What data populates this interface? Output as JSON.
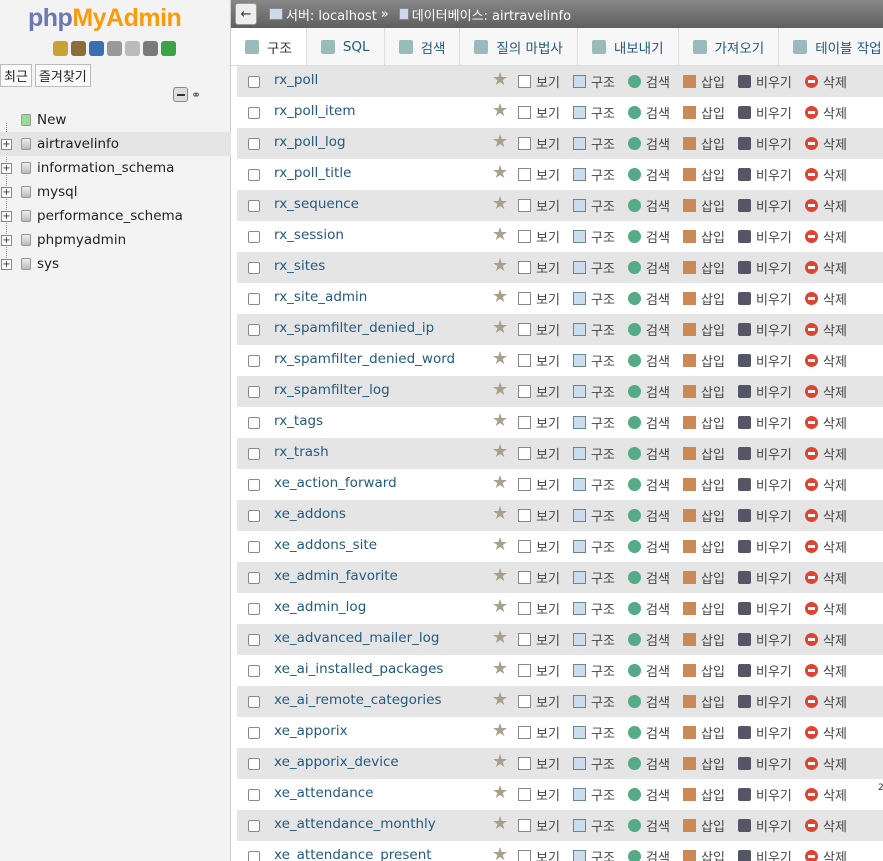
{
  "sidebar": {
    "logo_php": "php",
    "logo_myadmin": "MyAdmin",
    "nav_icons": [
      {
        "name": "home-icon",
        "color": "#c9a236"
      },
      {
        "name": "logout-icon",
        "color": "#8a6d3b"
      },
      {
        "name": "help-icon",
        "color": "#3a6fb0"
      },
      {
        "name": "docs-icon",
        "color": "#999999"
      },
      {
        "name": "copy-icon",
        "color": "#bbbbbb"
      },
      {
        "name": "settings-icon",
        "color": "#7a7a7a"
      },
      {
        "name": "reload-icon",
        "color": "#3aa346"
      }
    ],
    "recent_label": "최근",
    "favorites_label": "즐겨찾기",
    "new_label": "New",
    "databases": [
      "airtravelinfo",
      "information_schema",
      "mysql",
      "performance_schema",
      "phpmyadmin",
      "sys"
    ],
    "active_db": "airtravelinfo"
  },
  "breadcrumb": {
    "server": "서버: localhost",
    "separator": "»",
    "database": "데이터베이스: airtravelinfo"
  },
  "tabs": [
    "구조",
    "SQL",
    "검색",
    "질의 마법사",
    "내보내기",
    "가져오기",
    "테이블 작업"
  ],
  "actions": {
    "browse": "보기",
    "structure": "구조",
    "search": "검색",
    "insert": "삽입",
    "empty": "비우기",
    "drop": "삭제"
  },
  "tables": [
    "rx_poll",
    "rx_poll_item",
    "rx_poll_log",
    "rx_poll_title",
    "rx_sequence",
    "rx_session",
    "rx_sites",
    "rx_site_admin",
    "rx_spamfilter_denied_ip",
    "rx_spamfilter_denied_word",
    "rx_spamfilter_log",
    "rx_tags",
    "rx_trash",
    "xe_action_forward",
    "xe_addons",
    "xe_addons_site",
    "xe_admin_favorite",
    "xe_admin_log",
    "xe_advanced_mailer_log",
    "xe_ai_installed_packages",
    "xe_ai_remote_categories",
    "xe_apporix",
    "xe_apporix_device",
    "xe_attendance",
    "xe_attendance_monthly",
    "xe_attendance_present"
  ],
  "extra_marker": "2"
}
